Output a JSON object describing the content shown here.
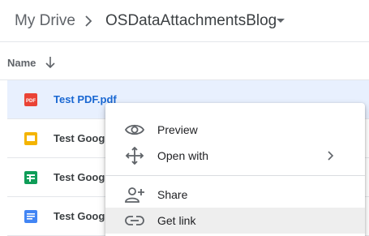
{
  "breadcrumb": {
    "root": "My Drive",
    "current": "OSDataAttachmentsBlog"
  },
  "file_list": {
    "name_column": "Name",
    "files": [
      {
        "name": "Test PDF.pdf",
        "type_icon": "pdf-icon",
        "selected": true,
        "color": "#ea4335"
      },
      {
        "name": "Test Google",
        "type_icon": "slides-icon",
        "selected": false,
        "color": "#f4b400"
      },
      {
        "name": "Test Google",
        "type_icon": "sheets-icon",
        "selected": false,
        "color": "#0f9d58"
      },
      {
        "name": "Test Google",
        "type_icon": "docs-icon",
        "selected": false,
        "color": "#4285f4"
      }
    ]
  },
  "context_menu": {
    "items": [
      {
        "label": "Preview",
        "icon": "eye-icon"
      },
      {
        "label": "Open with",
        "icon": "move-arrows-icon",
        "has_submenu": true
      },
      {
        "label": "Share",
        "icon": "add-person-icon"
      },
      {
        "label": "Get link",
        "icon": "link-icon",
        "hovered": true
      }
    ]
  },
  "colors": {
    "selected_background": "#e8f0fe",
    "selected_text": "#1967d2",
    "hover_background": "#eeeeee"
  }
}
